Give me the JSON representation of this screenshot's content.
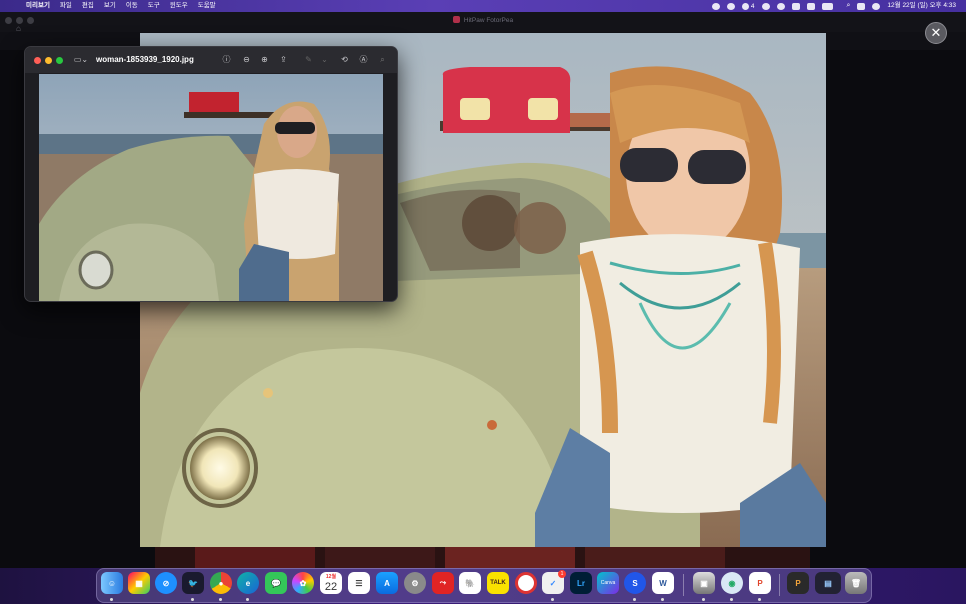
{
  "menubar": {
    "app_name": "미리보기",
    "items": [
      "파일",
      "편집",
      "보기",
      "이동",
      "도구",
      "윈도우",
      "도움말"
    ],
    "clock": "12월 22일 (일) 오후 4:33",
    "status_badge": "4"
  },
  "app": {
    "title": "HitPaw FotorPea"
  },
  "preview": {
    "filename": "woman-1853939_1920.jpg"
  },
  "dock": {
    "calendar_month": "12월",
    "calendar_day": "22",
    "talk_label": "TALK",
    "lr_label": "Lr",
    "canva_label": "Canva",
    "badge_count": "1"
  },
  "colors": {
    "menubar": "#4a35a8",
    "close_red": "#ff5f57",
    "minimize_yellow": "#febc2e",
    "zoom_green": "#28c840"
  }
}
